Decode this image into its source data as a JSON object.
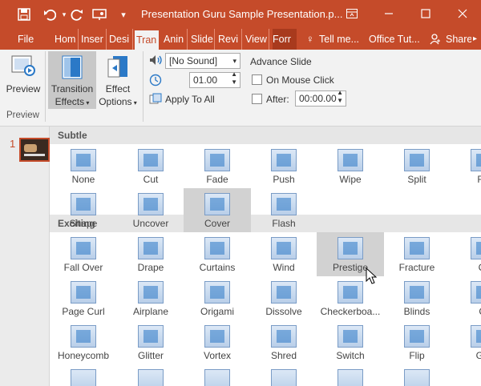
{
  "titlebar": {
    "title": "Presentation Guru Sample Presentation.p...",
    "icons": [
      "save-icon",
      "undo-icon",
      "redo-icon",
      "present-icon",
      "customize-icon"
    ],
    "restore_icon": "ribbon-display-icon",
    "min_icon": "minimize-icon",
    "max_icon": "maximize-icon",
    "close_icon": "close-icon"
  },
  "tabs": [
    {
      "label": "File"
    },
    {
      "label": "Hom"
    },
    {
      "label": "Inser"
    },
    {
      "label": "Desi"
    },
    {
      "label": "Tran"
    },
    {
      "label": "Anin"
    },
    {
      "label": "Slide"
    },
    {
      "label": "Revi"
    },
    {
      "label": "View"
    },
    {
      "label": "Forr"
    },
    {
      "label": "Tell me..."
    },
    {
      "label": "Office Tut..."
    },
    {
      "label": "Share"
    }
  ],
  "ribbon": {
    "preview_label": "Preview",
    "preview_group": "Preview",
    "transition_effects_line1": "Transition",
    "transition_effects_line2": "Effects",
    "effect_options_line1": "Effect",
    "effect_options_line2": "Options",
    "sound_value": "[No Sound]",
    "duration_value": "01.00",
    "apply_to_all": "Apply To All",
    "advance_slide": "Advance Slide",
    "on_mouse_click": "On Mouse Click",
    "after_label": "After:",
    "after_value": "00:00.00"
  },
  "slidepane": {
    "slide_number": "1"
  },
  "gallery": {
    "subtle_heading": "Subtle",
    "exciting_heading": "Exciting",
    "subtle": [
      "None",
      "Cut",
      "Fade",
      "Push",
      "Wipe",
      "Split",
      "Re",
      "Shape",
      "Uncover",
      "Cover",
      "Flash"
    ],
    "exciting": [
      "Fall Over",
      "Drape",
      "Curtains",
      "Wind",
      "Prestige",
      "Fracture",
      "Cr",
      "Page Curl",
      "Airplane",
      "Origami",
      "Dissolve",
      "Checkerboa...",
      "Blinds",
      "Cl",
      "Honeycomb",
      "Glitter",
      "Vortex",
      "Shred",
      "Switch",
      "Flip",
      "Gal"
    ]
  },
  "colors": {
    "accent": "#c54b2a",
    "ribbon": "#f2f2f2",
    "hover": "#d2d2d2",
    "heading": "#e6e6e6"
  }
}
